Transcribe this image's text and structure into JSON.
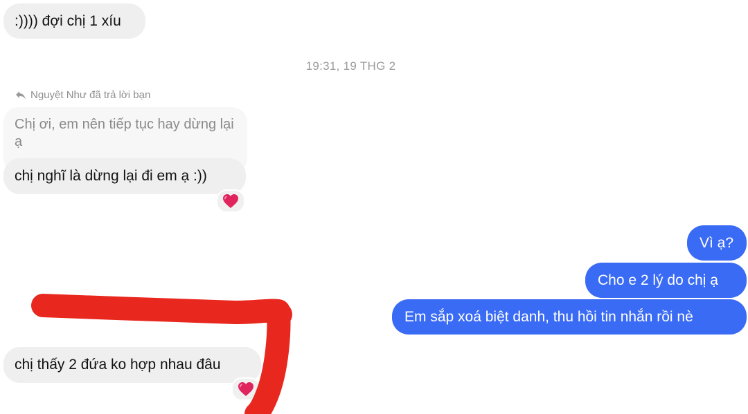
{
  "messages": {
    "first_incoming": ":)))) đợi chị 1 xíu",
    "timestamp": "19:31, 19 THG 2",
    "reply_note": "Nguyệt Như đã trả lời bạn",
    "quoted_message": "Chị ơi, em nên tiếp tục hay dừng lại ạ",
    "reply_incoming": "chị nghĩ là dừng lại đi em ạ :))",
    "outgoing": [
      "Vì ạ?",
      "Cho e 2 lý do chị ạ",
      "Em sắp xoá biệt danh, thu hồi tin nhắn rồi nè"
    ],
    "last_incoming": "chị thấy 2 đứa ko hợp nhau đâu"
  },
  "icons": {
    "reply": "reply-arrow-icon",
    "reaction": "red-heart-icon"
  },
  "colors": {
    "incoming_bubble": "#efefef",
    "outgoing_bubble": "#3a6bf4",
    "scribble": "#e8281e",
    "heart": "#e0245e"
  }
}
